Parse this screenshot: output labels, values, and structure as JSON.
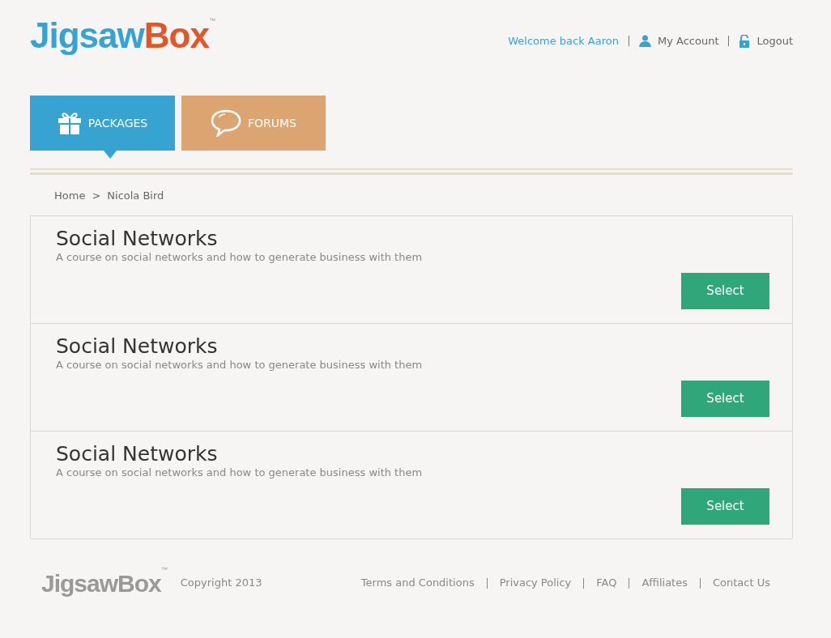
{
  "header": {
    "logo": {
      "part_1": "Jigsaw",
      "part_2": "Box",
      "mark": "™"
    },
    "welcome": "Welcome back Aaron",
    "links": [
      {
        "kind": "account",
        "label": "My Account"
      },
      {
        "kind": "logout",
        "label": "Logout"
      }
    ]
  },
  "tabs": [
    {
      "kind": "gift",
      "label": "PACKAGES",
      "selected": true,
      "color": "#36a3d1"
    },
    {
      "kind": "chat",
      "label": "FORUMS",
      "selected": false,
      "color": "#dca470"
    }
  ],
  "breadcrumb": [
    "Home",
    "Nicola Bird"
  ],
  "breadcrumb_separator": ">",
  "courses": [
    {
      "title": "Social Networks",
      "description": "A course on social networks and how to generate business with them",
      "button": "Select"
    },
    {
      "title": "Social Networks",
      "description": "A course on social networks and how to generate business with them",
      "button": "Select"
    },
    {
      "title": "Social Networks",
      "description": "A course on social networks and how to generate business with them",
      "button": "Select"
    }
  ],
  "footer": {
    "logo": {
      "text": "JigsawBox",
      "mark": "™"
    },
    "copyright": "Copyright 2013",
    "links": [
      "Terms and Conditions",
      "Privacy Policy",
      "FAQ",
      "Affiliates",
      "Contact Us"
    ]
  }
}
